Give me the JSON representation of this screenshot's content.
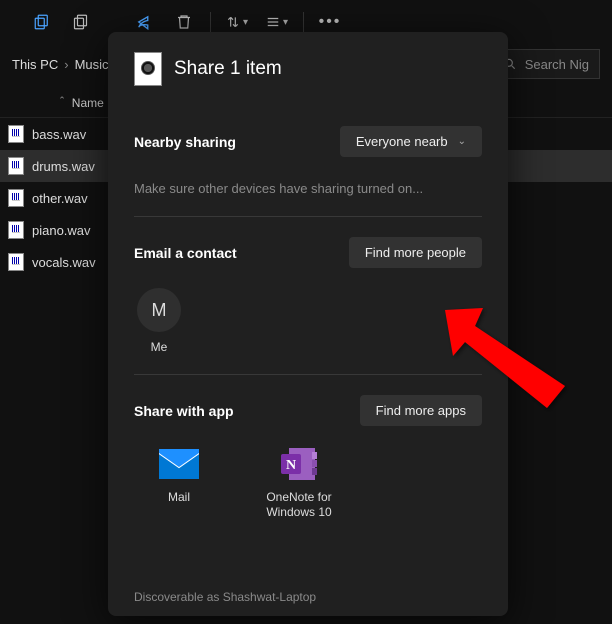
{
  "toolbar": {
    "icons": [
      "copy-icon",
      "new-window-icon",
      "share-icon",
      "delete-icon",
      "sort-icon",
      "view-icon",
      "more-icon"
    ]
  },
  "breadcrumb": {
    "segments": [
      "This PC",
      "Music"
    ]
  },
  "search": {
    "placeholder": "Search Nig"
  },
  "columns": {
    "name": "Name"
  },
  "files": [
    {
      "name": "bass.wav",
      "selected": false
    },
    {
      "name": "drums.wav",
      "selected": true
    },
    {
      "name": "other.wav",
      "selected": false
    },
    {
      "name": "piano.wav",
      "selected": false
    },
    {
      "name": "vocals.wav",
      "selected": false
    }
  ],
  "share": {
    "title": "Share 1 item",
    "nearby": {
      "label": "Nearby sharing",
      "dropdown": "Everyone nearb",
      "hint": "Make sure other devices have sharing turned on..."
    },
    "email": {
      "label": "Email a contact",
      "button": "Find more people",
      "contacts": [
        {
          "initial": "M",
          "name": "Me"
        }
      ]
    },
    "apps": {
      "label": "Share with app",
      "button": "Find more apps",
      "list": [
        {
          "name": "Mail"
        },
        {
          "name": "OneNote for Windows 10"
        }
      ]
    },
    "footer": "Discoverable as Shashwat-Laptop"
  }
}
